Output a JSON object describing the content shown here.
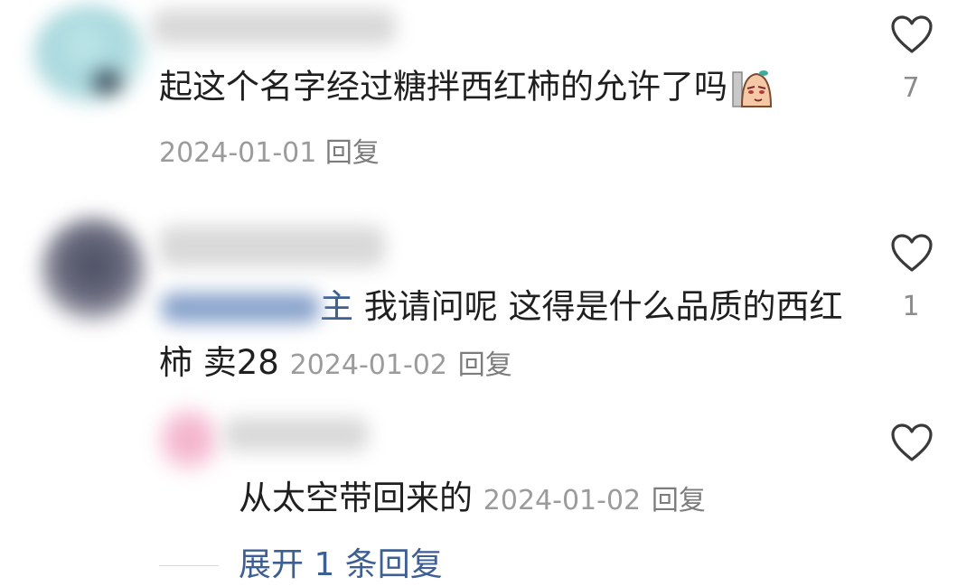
{
  "comments": [
    {
      "text": "起这个名字经过糖拌西红柿的允许了吗",
      "date": "2024-01-01",
      "reply_label": "回复",
      "likes": "7",
      "sticker_icon": "face-emoji-sticker"
    },
    {
      "mention_suffix": "主",
      "text_line1": "我请问呢 这得是什么品质的西红",
      "text_line2": "柿 卖28",
      "date": "2024-01-02",
      "reply_label": "回复",
      "likes": "1"
    }
  ],
  "reply": {
    "text": "从太空带回来的",
    "date": "2024-01-02",
    "reply_label": "回复"
  },
  "expand_label": "展开 1 条回复",
  "colors": {
    "text": "#1f1f1f",
    "meta": "#9b9b9b",
    "link_blue": "#3e5f93",
    "heart_stroke": "#3a3a3a"
  }
}
